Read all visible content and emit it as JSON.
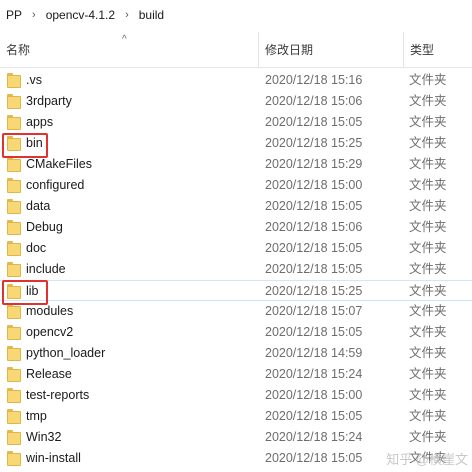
{
  "breadcrumb": {
    "items": [
      "PP",
      "opencv-4.1.2",
      "build"
    ],
    "separator": "›"
  },
  "columns": {
    "name": "名称",
    "date": "修改日期",
    "type": "类型",
    "sort_indicator": "^"
  },
  "rows": [
    {
      "name": ".vs",
      "date": "2020/12/18 15:16",
      "type": "文件夹",
      "icon": "folder-icon"
    },
    {
      "name": "3rdparty",
      "date": "2020/12/18 15:06",
      "type": "文件夹",
      "icon": "folder-icon"
    },
    {
      "name": "apps",
      "date": "2020/12/18 15:05",
      "type": "文件夹",
      "icon": "folder-icon"
    },
    {
      "name": "bin",
      "date": "2020/12/18 15:25",
      "type": "文件夹",
      "icon": "folder-icon",
      "highlighted": true
    },
    {
      "name": "CMakeFiles",
      "date": "2020/12/18 15:29",
      "type": "文件夹",
      "icon": "folder-icon"
    },
    {
      "name": "configured",
      "date": "2020/12/18 15:00",
      "type": "文件夹",
      "icon": "folder-icon"
    },
    {
      "name": "data",
      "date": "2020/12/18 15:05",
      "type": "文件夹",
      "icon": "folder-icon"
    },
    {
      "name": "Debug",
      "date": "2020/12/18 15:06",
      "type": "文件夹",
      "icon": "folder-icon"
    },
    {
      "name": "doc",
      "date": "2020/12/18 15:05",
      "type": "文件夹",
      "icon": "folder-icon"
    },
    {
      "name": "include",
      "date": "2020/12/18 15:05",
      "type": "文件夹",
      "icon": "folder-icon"
    },
    {
      "name": "lib",
      "date": "2020/12/18 15:25",
      "type": "文件夹",
      "icon": "folder-icon",
      "highlighted": true,
      "selected": true
    },
    {
      "name": "modules",
      "date": "2020/12/18 15:07",
      "type": "文件夹",
      "icon": "folder-icon"
    },
    {
      "name": "opencv2",
      "date": "2020/12/18 15:05",
      "type": "文件夹",
      "icon": "folder-icon"
    },
    {
      "name": "python_loader",
      "date": "2020/12/18 14:59",
      "type": "文件夹",
      "icon": "folder-icon"
    },
    {
      "name": "Release",
      "date": "2020/12/18 15:24",
      "type": "文件夹",
      "icon": "folder-icon"
    },
    {
      "name": "test-reports",
      "date": "2020/12/18 15:00",
      "type": "文件夹",
      "icon": "folder-icon"
    },
    {
      "name": "tmp",
      "date": "2020/12/18 15:05",
      "type": "文件夹",
      "icon": "folder-icon"
    },
    {
      "name": "Win32",
      "date": "2020/12/18 15:24",
      "type": "文件夹",
      "icon": "folder-icon"
    },
    {
      "name": "win-install",
      "date": "2020/12/18 15:05",
      "type": "文件夹",
      "icon": "folder-icon"
    }
  ],
  "watermark": "知乎 @横崖文",
  "colors": {
    "highlight_box": "#e0322f",
    "folder_fill": "#f8d775",
    "folder_border": "#e0b54a",
    "selection_border": "#cce8ff"
  }
}
